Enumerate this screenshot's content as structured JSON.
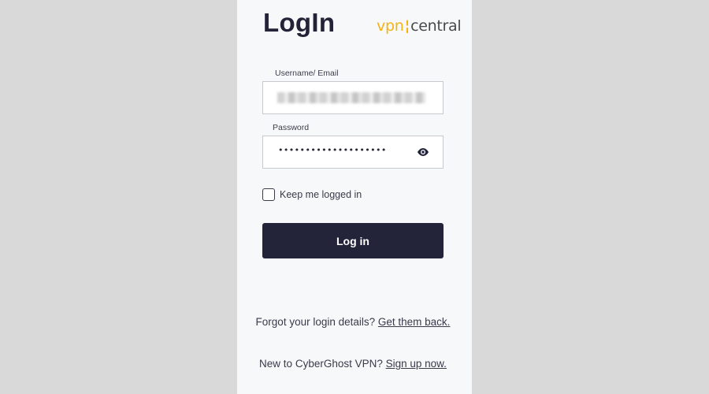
{
  "login": {
    "title": "LogIn",
    "logo": {
      "part1": "vpn",
      "separator": "¦",
      "part2": "central"
    },
    "username": {
      "label": "Username/ Email",
      "value": ""
    },
    "password": {
      "label": "Password",
      "value": "••••••••••••••••••••"
    },
    "keep_logged_in": {
      "label": "Keep me logged in",
      "checked": false
    },
    "submit_label": "Log in",
    "forgot": {
      "text": "Forgot your login details? ",
      "link": "Get them back."
    },
    "signup": {
      "text": "New to CyberGhost VPN? ",
      "link": "Sign up now."
    }
  },
  "colors": {
    "page_background": "#d9d9d9",
    "panel_background": "#f7f8fa",
    "button_background": "#23233a",
    "brand_yellow": "#f5b416"
  },
  "icons": {
    "password_toggle": "eye-icon"
  }
}
